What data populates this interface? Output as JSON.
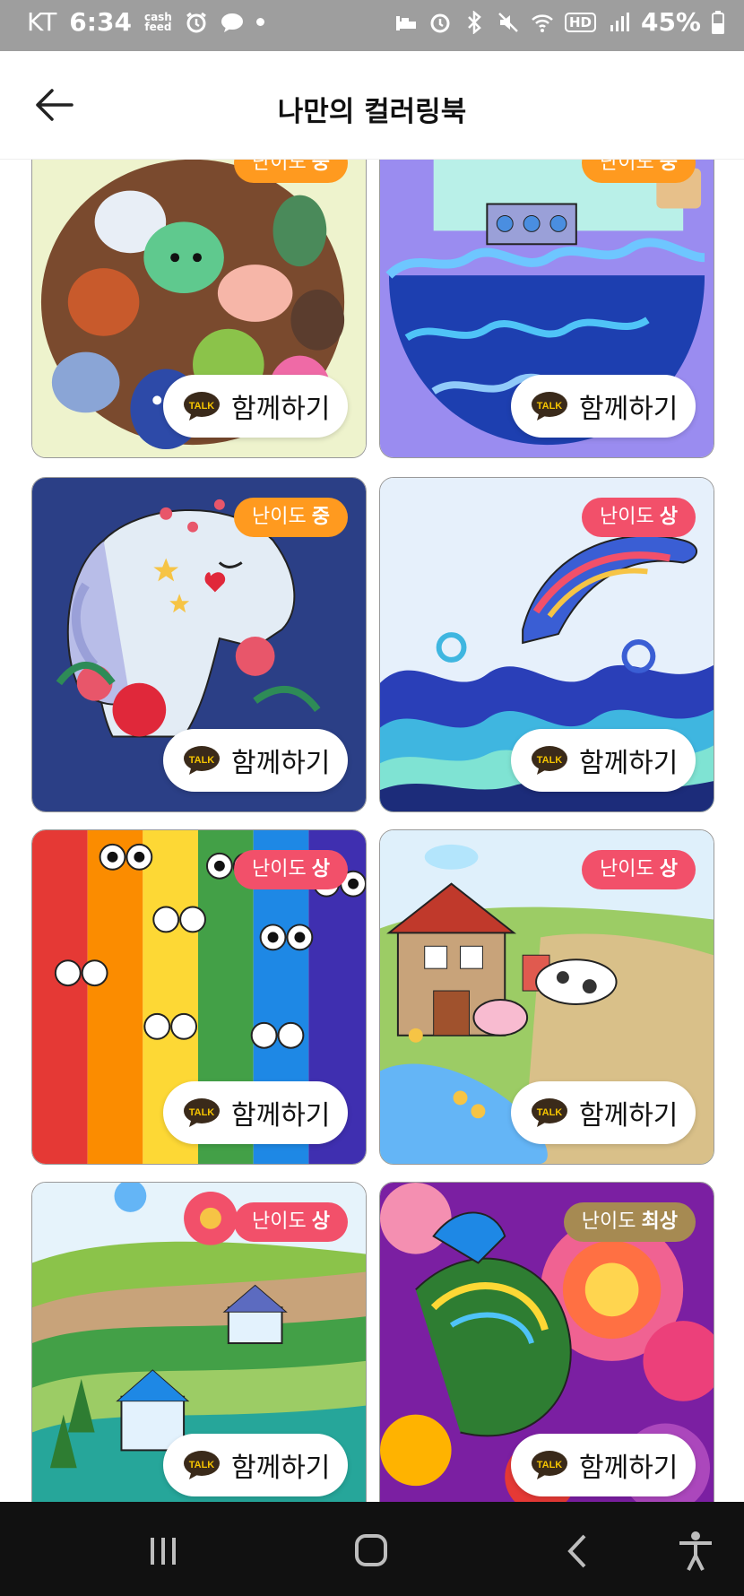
{
  "status_bar": {
    "carrier": "KT",
    "time": "6:34",
    "cash_label_top": "cash",
    "cash_label_bottom": "feed",
    "hd_label": "HD",
    "battery": "45%"
  },
  "header": {
    "title": "나만의 컬러링북"
  },
  "share_label": "함께하기",
  "talk_label": "TALK",
  "colors": {
    "badge_medium": "#ff9a1f",
    "badge_high": "#f2506a",
    "badge_top": "#a68a52"
  },
  "cards": [
    {
      "badge_prefix": "난이도",
      "badge_level": "중",
      "art": "forest-animals"
    },
    {
      "badge_prefix": "난이도",
      "badge_level": "중",
      "art": "ship-in-bottle"
    },
    {
      "badge_prefix": "난이도",
      "badge_level": "중",
      "art": "unicorn"
    },
    {
      "badge_prefix": "난이도",
      "badge_level": "상",
      "art": "dolphin-waves"
    },
    {
      "badge_prefix": "난이도",
      "badge_level": "상",
      "art": "rainbow-owls"
    },
    {
      "badge_prefix": "난이도",
      "badge_level": "상",
      "art": "farm"
    },
    {
      "badge_prefix": "난이도",
      "badge_level": "상",
      "art": "countryside"
    },
    {
      "badge_prefix": "난이도",
      "badge_level": "최상",
      "art": "mandala-bird"
    }
  ]
}
